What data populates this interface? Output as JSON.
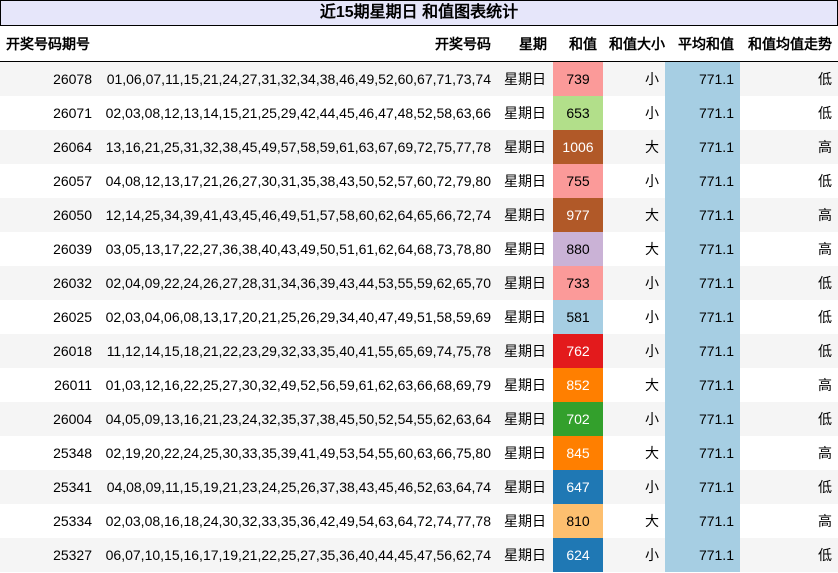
{
  "title": "近15期星期日 和值图表统计",
  "columns": [
    "开奖号码期号",
    "开奖号码",
    "星期",
    "和值",
    "和值大小",
    "平均和值",
    "和值均值走势"
  ],
  "rows": [
    {
      "period": "26078",
      "numbers": "01,06,07,11,15,21,24,27,31,32,34,38,46,49,52,60,67,71,73,74",
      "weekday": "星期日",
      "sum": "739",
      "size": "小",
      "avg": "771.1",
      "trend": "低",
      "color": "#fb9a99",
      "text_color": "#000000"
    },
    {
      "period": "26071",
      "numbers": "02,03,08,12,13,14,15,21,25,29,42,44,45,46,47,48,52,58,63,66",
      "weekday": "星期日",
      "sum": "653",
      "size": "小",
      "avg": "771.1",
      "trend": "低",
      "color": "#b2df8a",
      "text_color": "#000000"
    },
    {
      "period": "26064",
      "numbers": "13,16,21,25,31,32,38,45,49,57,58,59,61,63,67,69,72,75,77,78",
      "weekday": "星期日",
      "sum": "1006",
      "size": "大",
      "avg": "771.1",
      "trend": "高",
      "color": "#b15928",
      "text_color": "#ffffff"
    },
    {
      "period": "26057",
      "numbers": "04,08,12,13,17,21,26,27,30,31,35,38,43,50,52,57,60,72,79,80",
      "weekday": "星期日",
      "sum": "755",
      "size": "小",
      "avg": "771.1",
      "trend": "低",
      "color": "#fb9a99",
      "text_color": "#000000"
    },
    {
      "period": "26050",
      "numbers": "12,14,25,34,39,41,43,45,46,49,51,57,58,60,62,64,65,66,72,74",
      "weekday": "星期日",
      "sum": "977",
      "size": "大",
      "avg": "771.1",
      "trend": "高",
      "color": "#b15928",
      "text_color": "#ffffff"
    },
    {
      "period": "26039",
      "numbers": "03,05,13,17,22,27,36,38,40,43,49,50,51,61,62,64,68,73,78,80",
      "weekday": "星期日",
      "sum": "880",
      "size": "大",
      "avg": "771.1",
      "trend": "高",
      "color": "#cab2d6",
      "text_color": "#000000"
    },
    {
      "period": "26032",
      "numbers": "02,04,09,22,24,26,27,28,31,34,36,39,43,44,53,55,59,62,65,70",
      "weekday": "星期日",
      "sum": "733",
      "size": "小",
      "avg": "771.1",
      "trend": "低",
      "color": "#fb9a99",
      "text_color": "#000000"
    },
    {
      "period": "26025",
      "numbers": "02,03,04,06,08,13,17,20,21,25,26,29,34,40,47,49,51,58,59,69",
      "weekday": "星期日",
      "sum": "581",
      "size": "小",
      "avg": "771.1",
      "trend": "低",
      "color": "#a6cee3",
      "text_color": "#000000"
    },
    {
      "period": "26018",
      "numbers": "11,12,14,15,18,21,22,23,29,32,33,35,40,41,55,65,69,74,75,78",
      "weekday": "星期日",
      "sum": "762",
      "size": "小",
      "avg": "771.1",
      "trend": "低",
      "color": "#e31a1c",
      "text_color": "#ffffff"
    },
    {
      "period": "26011",
      "numbers": "01,03,12,16,22,25,27,30,32,49,52,56,59,61,62,63,66,68,69,79",
      "weekday": "星期日",
      "sum": "852",
      "size": "大",
      "avg": "771.1",
      "trend": "高",
      "color": "#ff7f00",
      "text_color": "#ffffff"
    },
    {
      "period": "26004",
      "numbers": "04,05,09,13,16,21,23,24,32,35,37,38,45,50,52,54,55,62,63,64",
      "weekday": "星期日",
      "sum": "702",
      "size": "小",
      "avg": "771.1",
      "trend": "低",
      "color": "#33a02c",
      "text_color": "#ffffff"
    },
    {
      "period": "25348",
      "numbers": "02,19,20,22,24,25,30,33,35,39,41,49,53,54,55,60,63,66,75,80",
      "weekday": "星期日",
      "sum": "845",
      "size": "大",
      "avg": "771.1",
      "trend": "高",
      "color": "#ff7f00",
      "text_color": "#ffffff"
    },
    {
      "period": "25341",
      "numbers": "04,08,09,11,15,19,21,23,24,25,26,37,38,43,45,46,52,63,64,74",
      "weekday": "星期日",
      "sum": "647",
      "size": "小",
      "avg": "771.1",
      "trend": "低",
      "color": "#1f78b4",
      "text_color": "#ffffff"
    },
    {
      "period": "25334",
      "numbers": "02,03,08,16,18,24,30,32,33,35,36,42,49,54,63,64,72,74,77,78",
      "weekday": "星期日",
      "sum": "810",
      "size": "大",
      "avg": "771.1",
      "trend": "高",
      "color": "#fdbf6f",
      "text_color": "#000000"
    },
    {
      "period": "25327",
      "numbers": "06,07,10,15,16,17,19,21,22,25,27,35,36,40,44,45,47,56,62,74",
      "weekday": "星期日",
      "sum": "624",
      "size": "小",
      "avg": "771.1",
      "trend": "低",
      "color": "#1f78b4",
      "text_color": "#ffffff"
    }
  ]
}
